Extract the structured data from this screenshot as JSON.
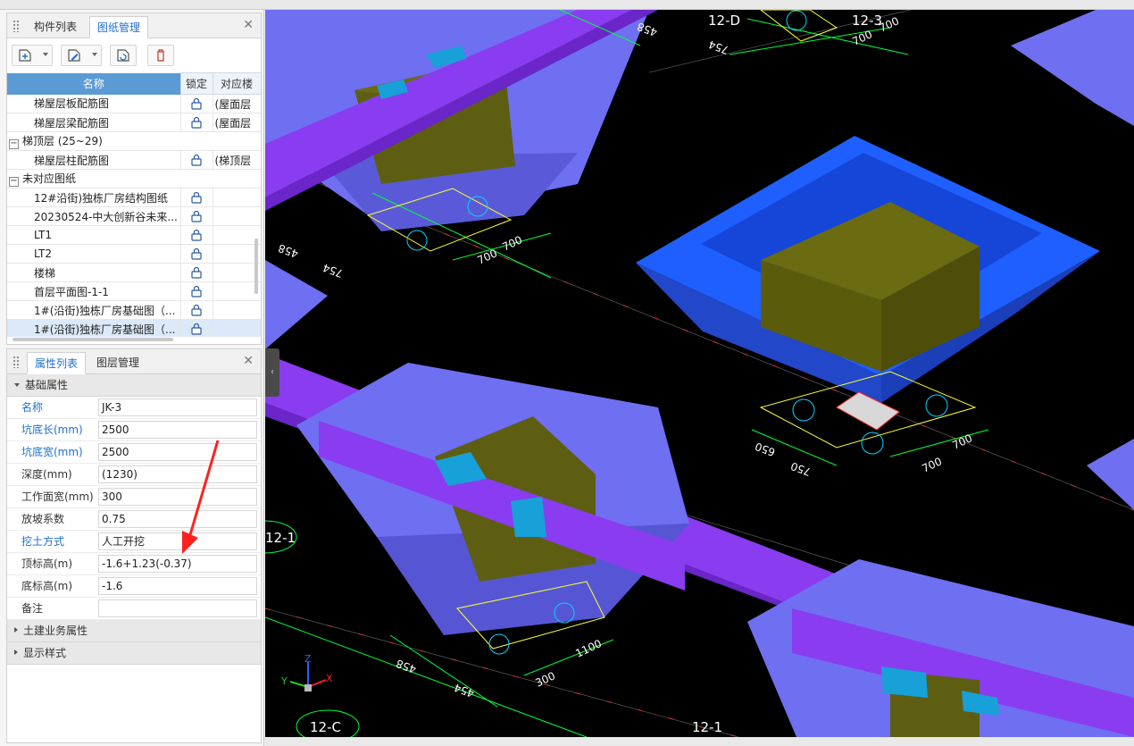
{
  "drawing_panel": {
    "tabs": [
      "构件列表",
      "图纸管理"
    ],
    "active_tab": 1,
    "columns": [
      "名称",
      "锁定",
      "对应楼"
    ],
    "rows": [
      {
        "name": "梯屋层板配筋图",
        "floor": "(屋面层",
        "indent": 2,
        "type": "item"
      },
      {
        "name": "梯屋层梁配筋图",
        "floor": "(屋面层",
        "indent": 2,
        "type": "item"
      },
      {
        "name": "梯顶层 (25~29)",
        "floor": "",
        "indent": 0,
        "type": "group"
      },
      {
        "name": "梯屋层柱配筋图",
        "floor": "(梯顶层",
        "indent": 2,
        "type": "item"
      },
      {
        "name": "未对应图纸",
        "floor": "",
        "indent": 0,
        "type": "group"
      },
      {
        "name": "12#沿街)独栋厂房结构图纸",
        "floor": "",
        "indent": 2,
        "type": "item"
      },
      {
        "name": "20230524-中大创新谷未来...",
        "floor": "",
        "indent": 2,
        "type": "item"
      },
      {
        "name": "LT1",
        "floor": "",
        "indent": 2,
        "type": "item"
      },
      {
        "name": "LT2",
        "floor": "",
        "indent": 2,
        "type": "item"
      },
      {
        "name": "楼梯",
        "floor": "",
        "indent": 2,
        "type": "item"
      },
      {
        "name": "首层平面图-1-1",
        "floor": "",
        "indent": 2,
        "type": "item"
      },
      {
        "name": "1#(沿街)独栋厂房基础图（...",
        "floor": "",
        "indent": 2,
        "type": "item"
      },
      {
        "name": "1#(沿街)独栋厂房基础图（...",
        "floor": "",
        "indent": 2,
        "type": "item",
        "selected": true
      }
    ]
  },
  "property_panel": {
    "tabs": [
      "属性列表",
      "图层管理"
    ],
    "active_tab": 0,
    "sections": {
      "basic": "基础属性",
      "civil": "土建业务属性",
      "display": "显示样式"
    },
    "properties": [
      {
        "key": "名称",
        "value": "JK-3",
        "blue": true
      },
      {
        "key": "坑底长(mm)",
        "value": "2500",
        "blue": true
      },
      {
        "key": "坑底宽(mm)",
        "value": "2500",
        "blue": true
      },
      {
        "key": "深度(mm)",
        "value": "(1230)",
        "blue": false
      },
      {
        "key": "工作面宽(mm)",
        "value": "300",
        "blue": false
      },
      {
        "key": "放坡系数",
        "value": "0.75",
        "blue": false
      },
      {
        "key": "挖土方式",
        "value": "人工开挖",
        "blue": true
      },
      {
        "key": "顶标高(m)",
        "value": "-1.6+1.23(-0.37)",
        "blue": false
      },
      {
        "key": "底标高(m)",
        "value": "-1.6",
        "blue": false
      },
      {
        "key": "备注",
        "value": "",
        "blue": false
      }
    ]
  },
  "viewport": {
    "axis_labels": [
      "12-D",
      "12-3",
      "12-1",
      "12-C",
      "12-1"
    ],
    "dims": [
      "458",
      "754",
      "700",
      "700",
      "458",
      "754",
      "700",
      "700",
      "650",
      "750",
      "700",
      "700",
      "458",
      "454",
      "300",
      "1100"
    ],
    "axes": [
      "Z",
      "Y",
      "X"
    ]
  },
  "colors": {
    "accent": "#1f6fd1",
    "header": "#5b9bd5",
    "pit_blue": "#1f5fff",
    "pit_violet": "#6e6ef0",
    "beam": "#8a3cf0",
    "footing": "#6b6b10",
    "dim": "#00ff3c"
  }
}
